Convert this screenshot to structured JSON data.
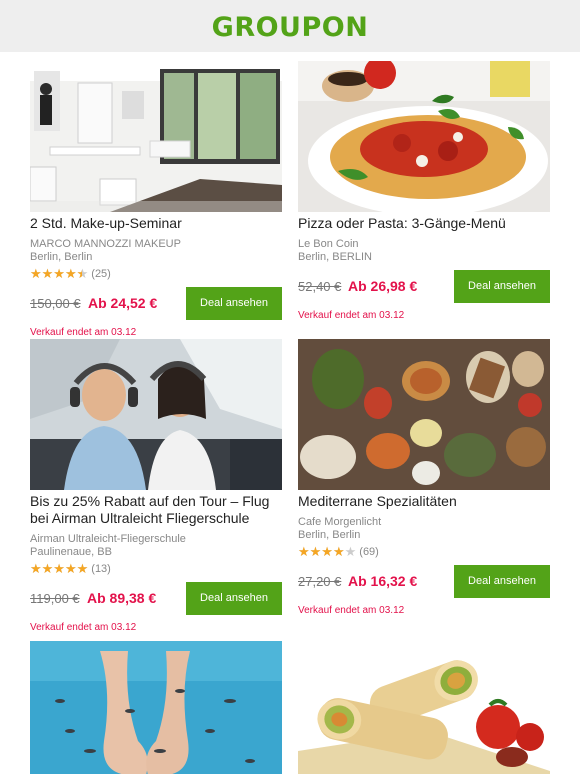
{
  "header": {
    "logo": "GROUPON",
    "brand_color": "#53a318"
  },
  "colors": {
    "price": "#e3124b",
    "button": "#53a318",
    "star": "#f5a623"
  },
  "deals": [
    {
      "title": "2 Std. Make-up-Seminar",
      "merchant": "MARCO MANNOZZI MAKEUP",
      "location": "Berlin, Berlin",
      "rating": 4.5,
      "rating_count": "(25)",
      "old_price": "150,00 €",
      "new_price": "Ab 24,52 €",
      "button": "Deal ansehen",
      "ends": "Verkauf endet am 03.12",
      "image": "studio-interior"
    },
    {
      "title": "Pizza oder Pasta: 3-Gänge-Menü",
      "merchant": "Le Bon Coin",
      "location": "Berlin, BERLIN",
      "old_price": "52,40 €",
      "new_price": "Ab 26,98 €",
      "button": "Deal ansehen",
      "ends": "Verkauf endet am 03.12",
      "image": "spaghetti-plate"
    },
    {
      "title": "Bis zu 25% Rabatt auf den Tour – Flug bei Airman Ultraleicht Fliegerschule",
      "merchant": "Airman Ultraleicht-Fliegerschule",
      "location": "Paulinenaue, BB",
      "rating": 5,
      "rating_count": "(13)",
      "old_price": "119,00 €",
      "new_price": "Ab 89,38 €",
      "button": "Deal ansehen",
      "ends": "Verkauf endet am 03.12",
      "image": "cockpit-couple"
    },
    {
      "title": "Mediterrane Spezialitäten",
      "merchant": "Cafe Morgenlicht",
      "location": "Berlin, Berlin",
      "rating": 4,
      "rating_count": "(69)",
      "old_price": "27,20 €",
      "new_price": "Ab 16,32 €",
      "button": "Deal ansehen",
      "ends": "Verkauf endet am 03.12",
      "image": "mezze-table"
    },
    {
      "image": "fish-spa-feet"
    },
    {
      "image": "wraps-tomatoes"
    }
  ]
}
